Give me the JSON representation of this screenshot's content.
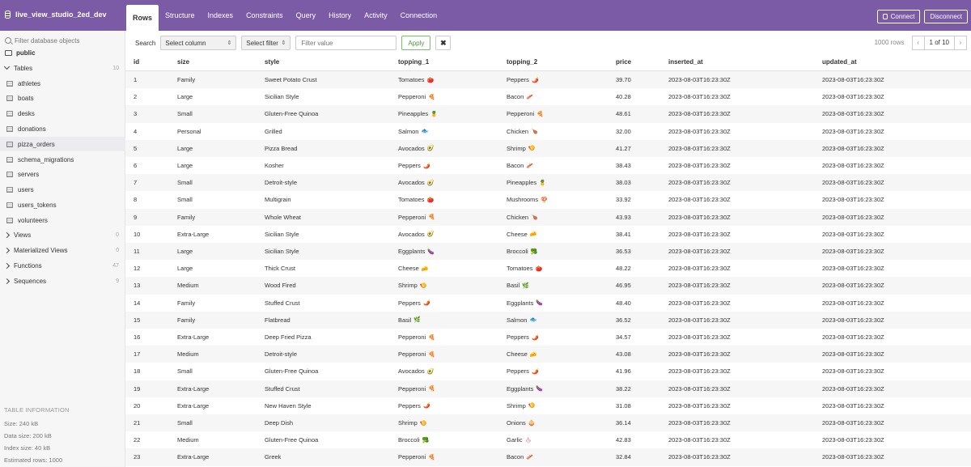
{
  "app": {
    "db_name": "live_view_studio_2ed_dev",
    "tabs": [
      "Rows",
      "Structure",
      "Indexes",
      "Constraints",
      "Query",
      "History",
      "Activity",
      "Connection"
    ],
    "active_tab": "Rows",
    "connect_label": "Connect",
    "disconnect_label": "Disconnect",
    "accent_color": "#7b5aa6"
  },
  "sidebar": {
    "filter_placeholder": "Filter database objects",
    "schema": "public",
    "tables_label": "Tables",
    "tables_count": "10",
    "tables": [
      "athletes",
      "boats",
      "desks",
      "donations",
      "pizza_orders",
      "schema_migrations",
      "servers",
      "users",
      "users_tokens",
      "volunteers"
    ],
    "active_table": "pizza_orders",
    "groups": [
      {
        "label": "Views",
        "count": "0"
      },
      {
        "label": "Materialized Views",
        "count": "0"
      },
      {
        "label": "Functions",
        "count": "47"
      },
      {
        "label": "Sequences",
        "count": "9"
      }
    ],
    "info": {
      "heading": "TABLE INFORMATION",
      "size": "Size: 240 kB",
      "data_size": "Data size: 200 kB",
      "index_size": "Index size: 40 kB",
      "estimated_rows": "Estimated rows: 1000"
    }
  },
  "toolbar": {
    "search_label": "Search",
    "select_column": "Select column",
    "select_filter": "Select filter",
    "filter_placeholder": "Filter value",
    "apply_label": "Apply",
    "clear_label": "✖",
    "row_count": "1000 rows",
    "page": "1 of 10",
    "prev": "‹",
    "next": "›"
  },
  "table": {
    "columns": [
      "id",
      "size",
      "style",
      "topping_1",
      "topping_2",
      "price",
      "inserted_at",
      "updated_at"
    ],
    "timestamp": "2023-08-03T16:23:30Z",
    "emoji": {
      "Tomatoes": "🍅",
      "Peppers": "🌶️",
      "Pepperoni": "🍕",
      "Bacon": "🥓",
      "Pineapples": "🍍",
      "Salmon": "🐟",
      "Chicken": "🍗",
      "Avocados": "🥑",
      "Shrimp": "🍤",
      "Mushrooms": "🍄",
      "Cheese": "🧀",
      "Eggplants": "🍆",
      "Broccoli": "🥦",
      "Basil": "🌿",
      "Onions": "🧅",
      "Garlic": "🧄"
    },
    "rows": [
      [
        "1",
        "Family",
        "Sweet Potato Crust",
        "Tomatoes",
        "Peppers",
        "39.70"
      ],
      [
        "2",
        "Large",
        "Sicilian Style",
        "Pepperoni",
        "Bacon",
        "40.28"
      ],
      [
        "3",
        "Small",
        "Gluten-Free Quinoa",
        "Pineapples",
        "Pepperoni",
        "48.61"
      ],
      [
        "4",
        "Personal",
        "Grilled",
        "Salmon",
        "Chicken",
        "32.00"
      ],
      [
        "5",
        "Large",
        "Pizza Bread",
        "Avocados",
        "Shrimp",
        "41.27"
      ],
      [
        "6",
        "Large",
        "Kosher",
        "Peppers",
        "Bacon",
        "38.43"
      ],
      [
        "7",
        "Small",
        "Detroit-style",
        "Avocados",
        "Pineapples",
        "38.03"
      ],
      [
        "8",
        "Small",
        "Multigrain",
        "Tomatoes",
        "Mushrooms",
        "33.92"
      ],
      [
        "9",
        "Family",
        "Whole Wheat",
        "Pepperoni",
        "Chicken",
        "43.93"
      ],
      [
        "10",
        "Extra-Large",
        "Sicilian Style",
        "Avocados",
        "Cheese",
        "38.41"
      ],
      [
        "11",
        "Large",
        "Sicilian Style",
        "Eggplants",
        "Broccoli",
        "36.53"
      ],
      [
        "12",
        "Large",
        "Thick Crust",
        "Cheese",
        "Tomatoes",
        "48.22"
      ],
      [
        "13",
        "Medium",
        "Wood Fired",
        "Shrimp",
        "Basil",
        "46.95"
      ],
      [
        "14",
        "Family",
        "Stuffed Crust",
        "Peppers",
        "Eggplants",
        "48.40"
      ],
      [
        "15",
        "Family",
        "Flatbread",
        "Basil",
        "Salmon",
        "36.52"
      ],
      [
        "16",
        "Extra-Large",
        "Deep Fried Pizza",
        "Pepperoni",
        "Peppers",
        "34.57"
      ],
      [
        "17",
        "Medium",
        "Detroit-style",
        "Pepperoni",
        "Cheese",
        "43.08"
      ],
      [
        "18",
        "Small",
        "Gluten-Free Quinoa",
        "Avocados",
        "Peppers",
        "41.96"
      ],
      [
        "19",
        "Extra-Large",
        "Stuffed Crust",
        "Pepperoni",
        "Eggplants",
        "38.22"
      ],
      [
        "20",
        "Extra-Large",
        "New Haven Style",
        "Peppers",
        "Shrimp",
        "31.08"
      ],
      [
        "21",
        "Small",
        "Deep Dish",
        "Shrimp",
        "Onions",
        "36.14"
      ],
      [
        "22",
        "Medium",
        "Gluten-Free Quinoa",
        "Broccoli",
        "Garlic",
        "42.83"
      ],
      [
        "23",
        "Extra-Large",
        "Greek",
        "Pepperoni",
        "Bacon",
        "32.84"
      ]
    ]
  }
}
